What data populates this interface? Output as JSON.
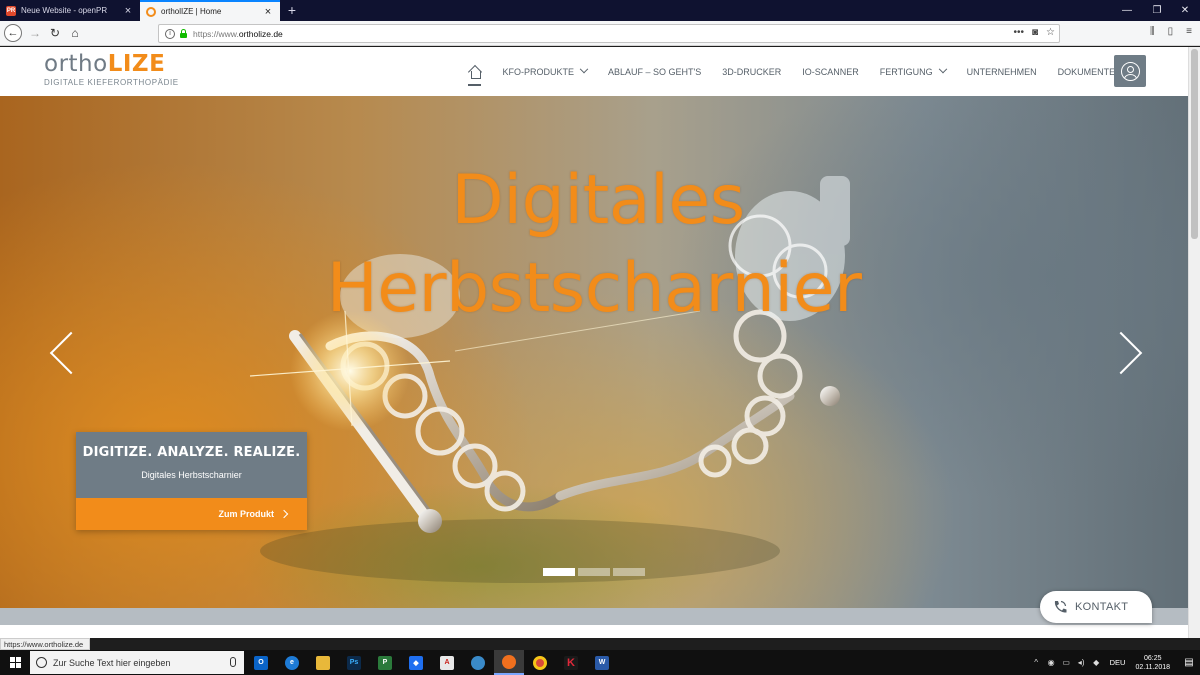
{
  "browser": {
    "tabs": [
      {
        "title": "Neue Website - openPR",
        "favicon": "openpr-icon",
        "active": false
      },
      {
        "title": "ortholIZE | Home",
        "favicon": "ortholize-icon",
        "active": true
      }
    ],
    "url_scheme": "https://www.",
    "url_host": "ortholize.de",
    "status_url": "https://www.ortholize.de"
  },
  "site": {
    "logo_part1": "ortho",
    "logo_part2": "LIZE",
    "logo_tagline": "DIGITALE KIEFERORTHOPÄDIE",
    "nav": [
      {
        "label": "KFO-PRODUKTE",
        "dropdown": true
      },
      {
        "label": "ABLAUF – SO GEHT'S",
        "dropdown": false
      },
      {
        "label": "3D-DRUCKER",
        "dropdown": false
      },
      {
        "label": "IO-SCANNER",
        "dropdown": false
      },
      {
        "label": "FERTIGUNG",
        "dropdown": true
      },
      {
        "label": "UNTERNEHMEN",
        "dropdown": false
      },
      {
        "label": "DOKUMENTE",
        "dropdown": false
      }
    ]
  },
  "hero": {
    "title_line1": "Digitales",
    "title_line2": "Herbstscharnier",
    "promo_heading": "DIGITIZE. ANALYZE. REALIZE.",
    "promo_subtitle": "Digitales Herbstscharnier",
    "promo_button": "Zum Produkt",
    "slide_count": 3,
    "active_slide": 1
  },
  "kontakt_label": "KONTAKT",
  "taskbar": {
    "search_placeholder": "Zur Suche Text hier eingeben",
    "language": "DEU",
    "time": "06:25",
    "date": "02.11.2018"
  },
  "colors": {
    "brand_orange": "#f28c1a",
    "brand_gray": "#6f7c86",
    "nav_text": "#555f68"
  }
}
